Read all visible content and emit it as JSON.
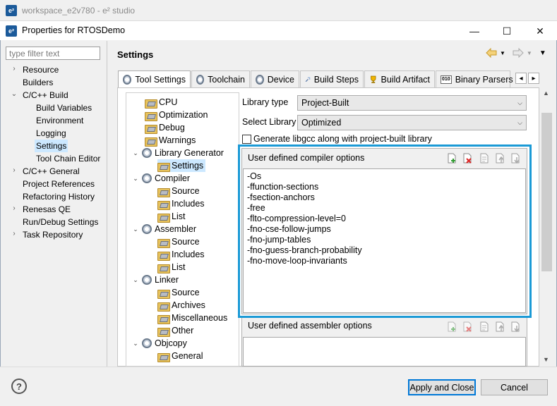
{
  "background_window": {
    "title": "workspace_e2v780 - e² studio",
    "icon": "e2-icon"
  },
  "dialog": {
    "title": "Properties for RTOSDemo",
    "icon": "e2-icon",
    "controls": {
      "minimize": "—",
      "maximize": "☐",
      "close": "✕"
    }
  },
  "sidebar": {
    "filter_placeholder": "type filter text",
    "items": [
      {
        "label": "Resource",
        "caret": "›"
      },
      {
        "label": "Builders"
      },
      {
        "label": "C/C++ Build",
        "caret": "⌄"
      },
      {
        "label": "Build Variables"
      },
      {
        "label": "Environment"
      },
      {
        "label": "Logging"
      },
      {
        "label": "Settings",
        "selected": true
      },
      {
        "label": "Tool Chain Editor"
      },
      {
        "label": "C/C++ General",
        "caret": "›"
      },
      {
        "label": "Project References"
      },
      {
        "label": "Refactoring History"
      },
      {
        "label": "Renesas QE",
        "caret": "›"
      },
      {
        "label": "Run/Debug Settings"
      },
      {
        "label": "Task Repository",
        "caret": "›"
      }
    ]
  },
  "header": {
    "title": "Settings",
    "nav_icons": [
      "back-arrow-icon",
      "forward-arrow-icon",
      "view-menu-icon"
    ]
  },
  "tabs": [
    {
      "label": "Tool Settings",
      "icon": "gear-icon",
      "active": true
    },
    {
      "label": "Toolchain",
      "icon": "gear-icon"
    },
    {
      "label": "Device",
      "icon": "gear-icon"
    },
    {
      "label": "Build Steps",
      "icon": "build-steps-icon"
    },
    {
      "label": "Build Artifact",
      "icon": "trophy-icon"
    },
    {
      "label": "Binary Parsers",
      "icon": "binary-icon"
    }
  ],
  "tab_scroll": {
    "left": "◂",
    "right": "▸"
  },
  "tool_tree": [
    {
      "label": "CPU",
      "type": "folder"
    },
    {
      "label": "Optimization",
      "type": "folder"
    },
    {
      "label": "Debug",
      "type": "folder"
    },
    {
      "label": "Warnings",
      "type": "folder"
    },
    {
      "label": "Library Generator",
      "type": "tool",
      "caret": "⌄"
    },
    {
      "label": "Settings",
      "type": "folder",
      "selected": true
    },
    {
      "label": "Compiler",
      "type": "tool",
      "caret": "⌄"
    },
    {
      "label": "Source",
      "type": "folder"
    },
    {
      "label": "Includes",
      "type": "folder"
    },
    {
      "label": "List",
      "type": "folder"
    },
    {
      "label": "Assembler",
      "type": "tool",
      "caret": "⌄"
    },
    {
      "label": "Source",
      "type": "folder"
    },
    {
      "label": "Includes",
      "type": "folder"
    },
    {
      "label": "List",
      "type": "folder"
    },
    {
      "label": "Linker",
      "type": "tool",
      "caret": "⌄"
    },
    {
      "label": "Source",
      "type": "folder"
    },
    {
      "label": "Archives",
      "type": "folder"
    },
    {
      "label": "Miscellaneous",
      "type": "folder"
    },
    {
      "label": "Other",
      "type": "folder"
    },
    {
      "label": "Objcopy",
      "type": "tool",
      "caret": "⌄"
    },
    {
      "label": "General",
      "type": "folder"
    }
  ],
  "settings": {
    "library_type_label": "Library type",
    "library_type_value": "Project-Built",
    "select_library_label": "Select Library",
    "select_library_value": "Optimized",
    "generate_libgcc_label": "Generate libgcc along with project-built library",
    "generate_libgcc_checked": false,
    "dropdown_arrow": "⌵"
  },
  "compiler_options": {
    "title": "User defined compiler options",
    "toolbar_icons": [
      "add-icon",
      "delete-icon",
      "edit-icon",
      "move-up-icon",
      "move-down-icon"
    ],
    "values": [
      "-Os",
      "-ffunction-sections",
      "-fsection-anchors",
      "-free",
      "-flto-compression-level=0",
      "-fno-cse-follow-jumps",
      "-fno-jump-tables",
      "-fno-guess-branch-probability",
      "-fno-move-loop-invariants"
    ],
    "highlight_color": "#1b9ad6"
  },
  "assembler_options": {
    "title": "User defined assembler options",
    "toolbar_icons": [
      "add-icon",
      "delete-icon",
      "edit-icon",
      "move-up-icon",
      "move-down-icon"
    ],
    "values": []
  },
  "footer": {
    "help_label": "?",
    "apply_close_label": "Apply and Close",
    "cancel_label": "Cancel"
  }
}
